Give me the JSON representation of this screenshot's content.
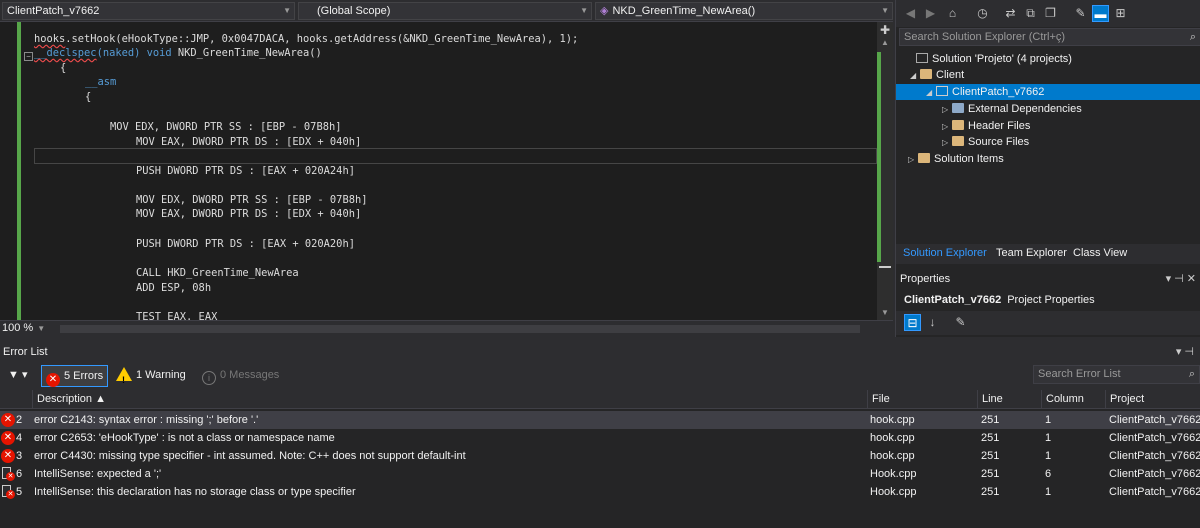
{
  "nav": {
    "project": "ClientPatch_v7662",
    "scope": "(Global Scope)",
    "member": "NKD_GreenTime_NewArea()"
  },
  "code": {
    "line1_a": "hooks",
    "line1_b": ".setHook(eHookType::JMP, 0x0047DACA, hooks.getAddress(&NKD_GreenTime_NewArea), 1);",
    "line2_a": "__declspec",
    "line2_b": "(naked) ",
    "line2_c": "void",
    "line2_d": " NKD_GreenTime_NewArea()",
    "line3": "{",
    "line4": "__asm",
    "line5": "{",
    "line6": "MOV EDX, DWORD PTR SS : [EBP - 07B8h]",
    "line7": "MOV EAX, DWORD PTR DS : [EDX + 040h]",
    "line8": "PUSH DWORD PTR DS : [EAX + 020A24h]",
    "line9": "MOV EDX, DWORD PTR SS : [EBP - 07B8h]",
    "line10": "MOV EAX, DWORD PTR DS : [EDX + 040h]",
    "line11": "PUSH DWORD PTR DS : [EAX + 020A20h]",
    "line12": "CALL HKD_GreenTime_NewArea",
    "line13": "ADD ESP, 08h",
    "line14": "TEST EAX, EAX"
  },
  "zoom": "100 %",
  "solution_explorer": {
    "search_placeholder": "Search Solution Explorer (Ctrl+ç)",
    "items": [
      {
        "label": "Solution 'Projeto' (4 projects)"
      },
      {
        "label": "Client"
      },
      {
        "label": "ClientPatch_v7662"
      },
      {
        "label": "External Dependencies"
      },
      {
        "label": "Header Files"
      },
      {
        "label": "Source Files"
      },
      {
        "label": "Solution Items"
      }
    ],
    "tabs": [
      "Solution Explorer",
      "Team Explorer",
      "Class View"
    ]
  },
  "properties": {
    "title": "Properties",
    "object_name": "ClientPatch_v7662",
    "object_type": "Project Properties"
  },
  "error_list": {
    "title": "Error List",
    "errors_filter": "5 Errors",
    "warnings_filter": "1 Warning",
    "messages_filter": "0 Messages",
    "search_placeholder": "Search Error List",
    "columns": [
      "Description",
      "File",
      "Line",
      "Column",
      "Project"
    ],
    "rows": [
      {
        "num": "2",
        "description": "error C2143: syntax error : missing ';' before '.'",
        "file": "hook.cpp",
        "line": "251",
        "column": "1",
        "project": "ClientPatch_v7662"
      },
      {
        "num": "4",
        "description": "error C2653: 'eHookType' : is not a class or namespace name",
        "file": "hook.cpp",
        "line": "251",
        "column": "1",
        "project": "ClientPatch_v7662"
      },
      {
        "num": "3",
        "description": "error C4430: missing type specifier - int assumed. Note: C++ does not support default-int",
        "file": "hook.cpp",
        "line": "251",
        "column": "1",
        "project": "ClientPatch_v7662"
      },
      {
        "num": "6",
        "description": "IntelliSense: expected a ';'",
        "file": "Hook.cpp",
        "line": "251",
        "column": "6",
        "project": "ClientPatch_v7662"
      },
      {
        "num": "5",
        "description": "IntelliSense: this declaration has no storage class or type specifier",
        "file": "Hook.cpp",
        "line": "251",
        "column": "1",
        "project": "ClientPatch_v7662"
      }
    ]
  },
  "colors": {
    "accent": "#007acc",
    "error": "#e51400",
    "warning": "#ffcc00",
    "changed_bar": "#57a64a",
    "keyword": "#569cd6"
  }
}
